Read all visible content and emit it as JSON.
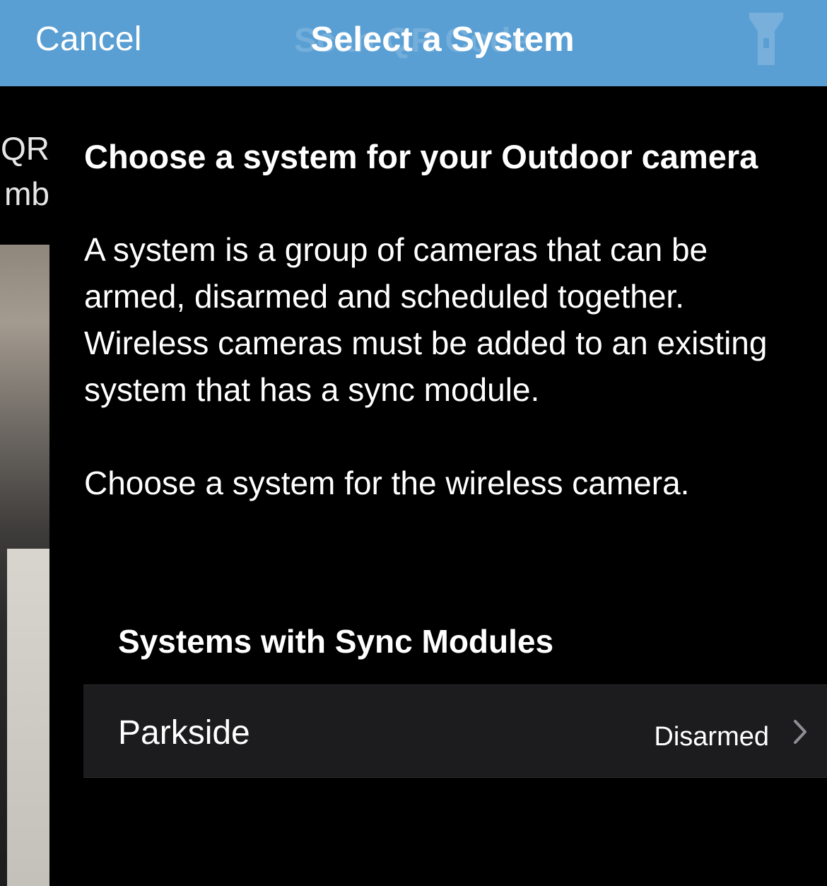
{
  "navbar": {
    "cancel_label": "Cancel",
    "title": "Select a System",
    "ghost_title": "Scan QR Code",
    "right_icon": "flashlight-icon"
  },
  "underlay": {
    "line1": "QR",
    "line2": "mb"
  },
  "content": {
    "heading": "Choose a system for your Outdoor camera",
    "paragraph1": "A system is a group of cameras that can be armed, disarmed and scheduled together. Wireless cameras must be added to an existing system that has a sync module.",
    "paragraph2": "Choose a system for the wireless camera."
  },
  "systems_section": {
    "header": "Systems with Sync Modules",
    "items": [
      {
        "name": "Parkside",
        "status": "Disarmed",
        "icon": "chevron-right-icon"
      }
    ]
  },
  "colors": {
    "navbar_bg": "#5a9fd4",
    "background": "#000000",
    "row_bg": "#1c1c1e",
    "text": "#ffffff",
    "chevron": "#8e8e93"
  }
}
